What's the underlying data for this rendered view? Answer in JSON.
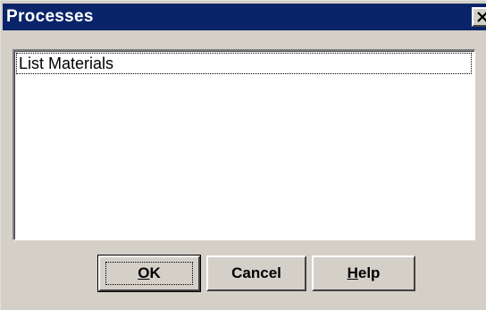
{
  "window": {
    "title": "Processes"
  },
  "icons": {
    "close": "close-icon"
  },
  "list": {
    "items": [
      "List Materials"
    ],
    "selected_index": 0
  },
  "buttons": {
    "ok": {
      "mnemonic": "O",
      "rest": "K",
      "is_default": true
    },
    "cancel": {
      "label": "Cancel"
    },
    "help": {
      "mnemonic": "H",
      "rest": "elp"
    }
  },
  "colors": {
    "titlebar": "#0a246a",
    "face": "#d4d0c8",
    "list_background": "#ffffff"
  }
}
